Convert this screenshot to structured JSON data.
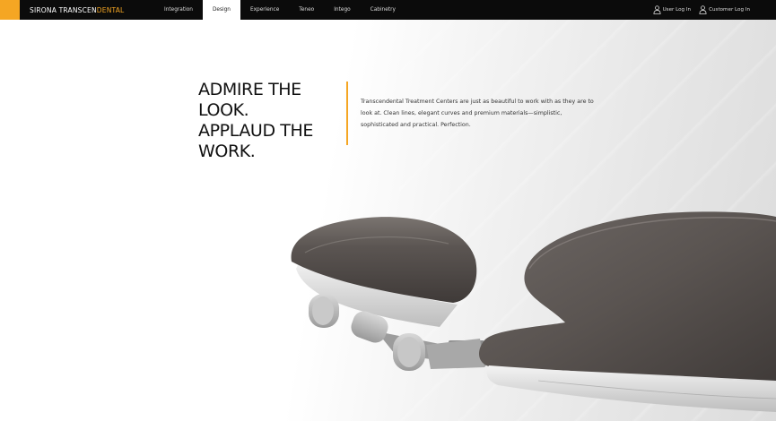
{
  "brand": {
    "prefix": "SIRONA TRANSCEN",
    "highlight": "DENTAL"
  },
  "nav": {
    "items": [
      {
        "label": "Integration",
        "active": false
      },
      {
        "label": "Design",
        "active": true
      },
      {
        "label": "Experience",
        "active": false
      },
      {
        "label": "Teneo",
        "active": false
      },
      {
        "label": "Intego",
        "active": false
      },
      {
        "label": "Cabinetry",
        "active": false
      }
    ]
  },
  "logins": {
    "user": "User Log In",
    "customer": "Customer Log In"
  },
  "hero": {
    "headline": "ADMIRE THE LOOK.\nAPPLAUD THE\nWORK.",
    "body": "Transcendental Treatment Centers are just as beautiful to work with as they are to look at. Clean lines, elegant curves and premium materials—simplistic, sophisticated and practical. Perfection."
  },
  "colors": {
    "accent": "#f5a623",
    "topbar": "#0b0b0b",
    "upholstery": "#5b5552"
  },
  "icons": {
    "user_login": "user-icon",
    "customer_login": "user-icon"
  }
}
